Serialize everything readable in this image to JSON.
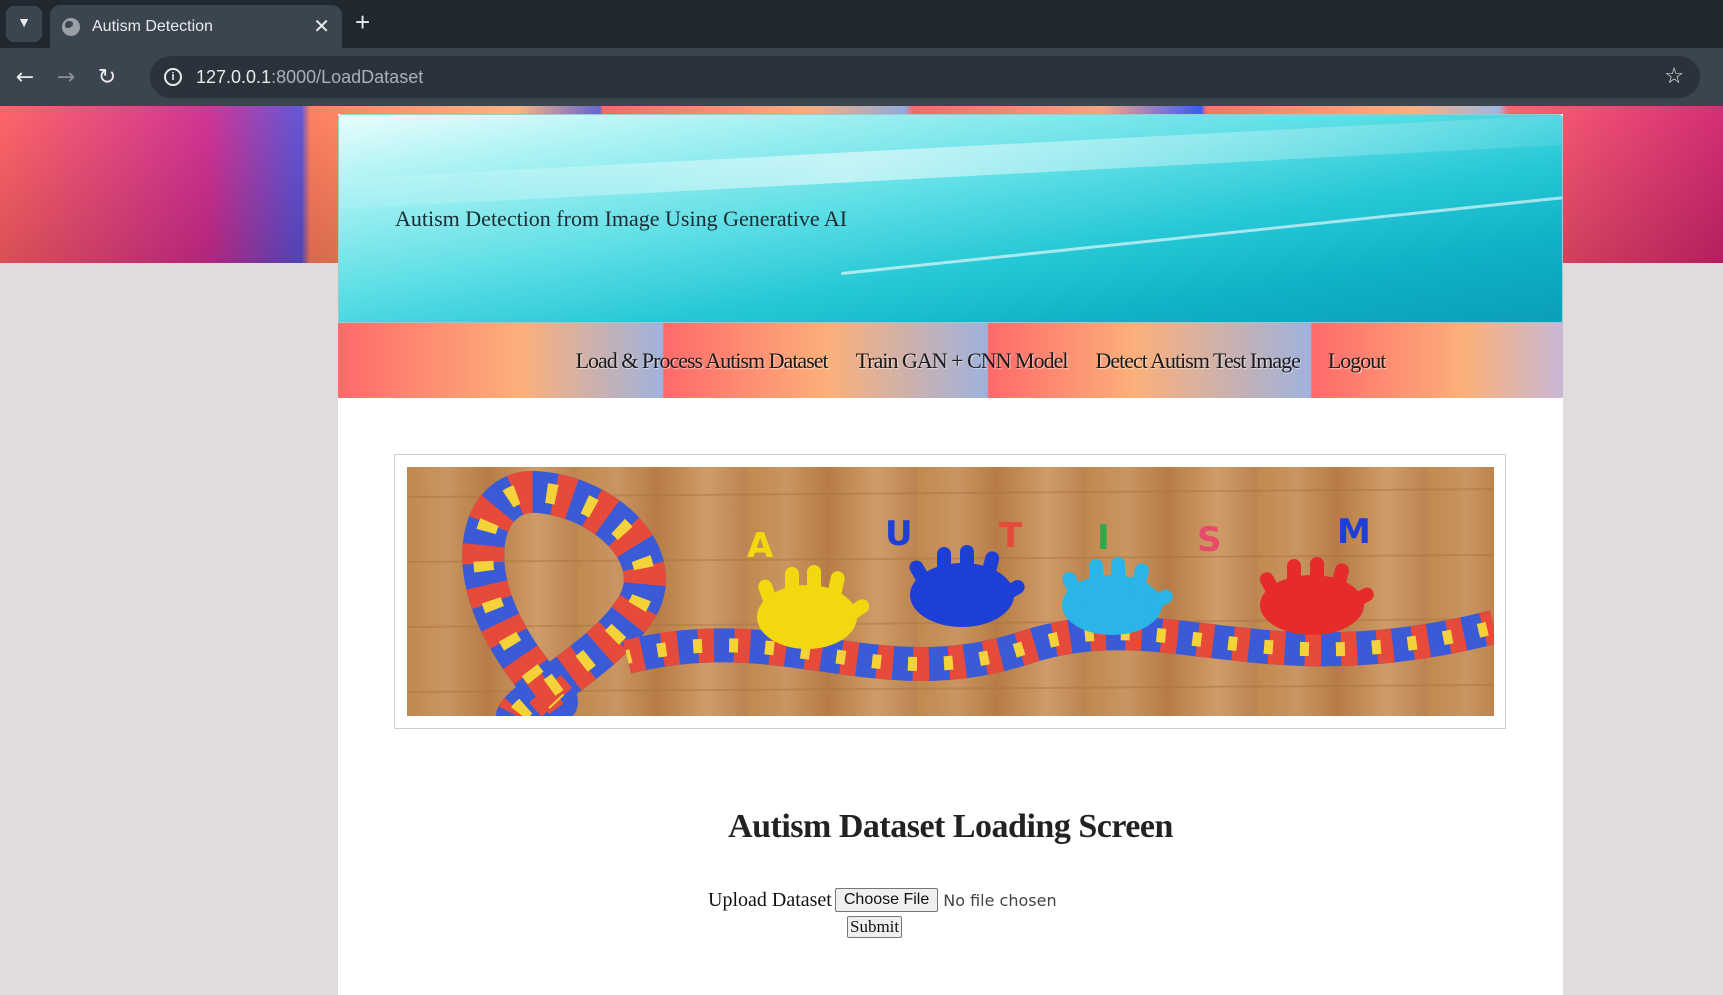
{
  "browser": {
    "tab_title": "Autism Detection",
    "tab_close": "✕",
    "new_tab": "+",
    "url_host": "127.0.0.1",
    "url_rest": ":8000/LoadDataset"
  },
  "header": {
    "title": "Autism Detection from Image Using Generative AI"
  },
  "menu": {
    "items": [
      "Load & Process Autism Dataset",
      "Train GAN + CNN Model",
      "Detect Autism Test Image",
      "Logout"
    ]
  },
  "banner": {
    "letters": [
      "A",
      "U",
      "T",
      "I",
      "S",
      "M"
    ]
  },
  "main": {
    "heading": "Autism Dataset Loading Screen",
    "upload_label": "Upload Dataset",
    "file_button": "Choose File",
    "file_status": "No file chosen",
    "submit_label": "Submit"
  },
  "colors": {
    "header_accent": "#27c8d6",
    "menu_red": "#ff6a6a",
    "menu_orange": "#fcb07a",
    "menu_blue": "#9fb2dd"
  }
}
